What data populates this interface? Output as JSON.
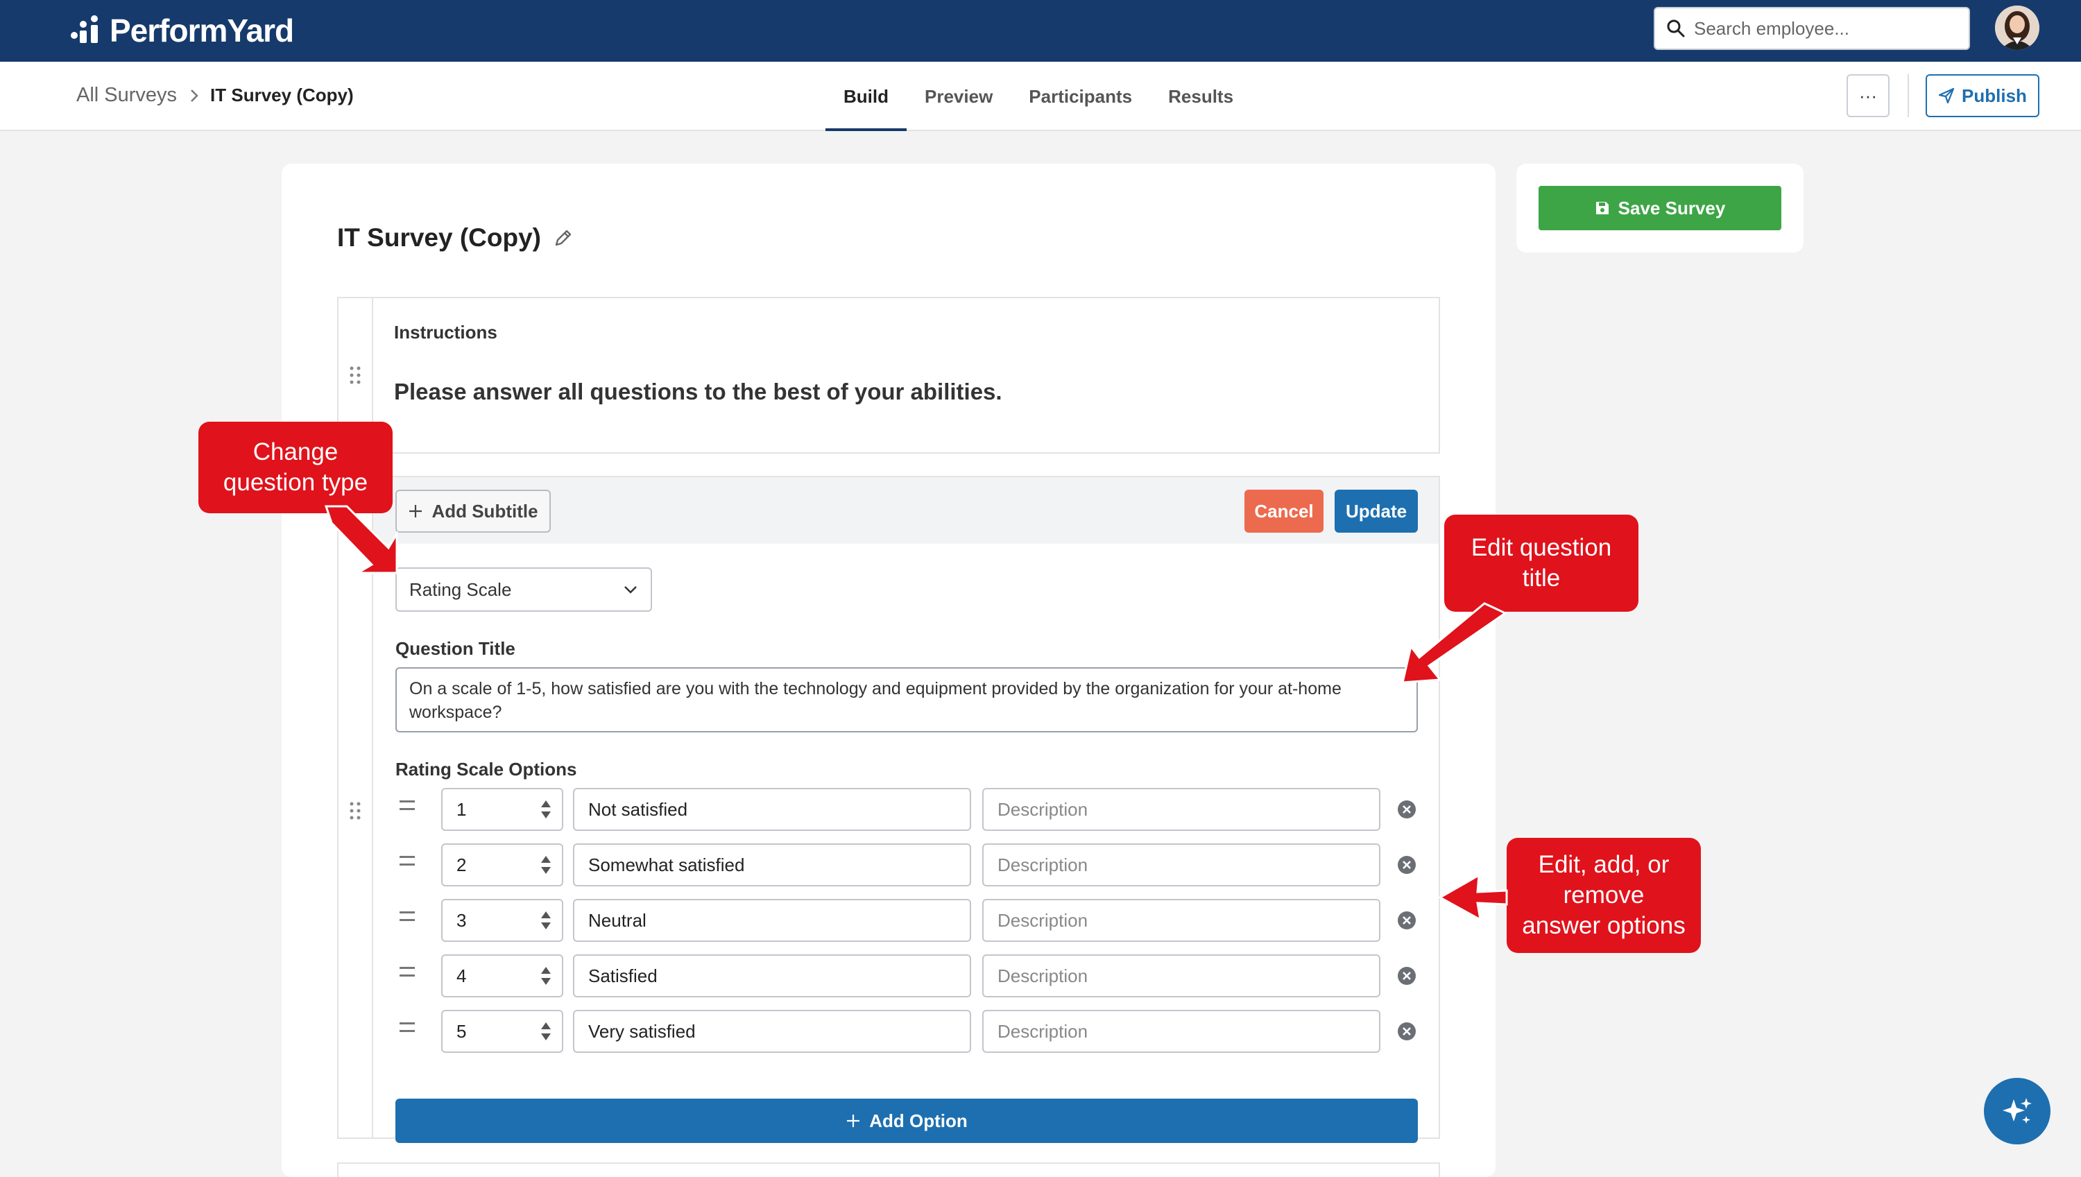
{
  "app": {
    "name": "PerformYard"
  },
  "search": {
    "placeholder": "Search employee..."
  },
  "breadcrumb": {
    "root": "All Surveys",
    "current": "IT Survey (Copy)"
  },
  "tabs": [
    {
      "label": "Build",
      "active": true
    },
    {
      "label": "Preview",
      "active": false
    },
    {
      "label": "Participants",
      "active": false
    },
    {
      "label": "Results",
      "active": false
    }
  ],
  "header_actions": {
    "more": "···",
    "publish": "Publish"
  },
  "survey": {
    "title": "IT Survey (Copy)"
  },
  "instructions": {
    "label": "Instructions",
    "text": "Please answer all questions to the best of your abilities."
  },
  "question": {
    "add_subtitle": "Add Subtitle",
    "cancel": "Cancel",
    "update": "Update",
    "type": "Rating Scale",
    "title_label": "Question Title",
    "title_value": "On a scale of 1-5, how satisfied are you with the technology and equipment provided by the organization for your at-home workspace?",
    "options_label": "Rating Scale Options",
    "description_placeholder": "Description",
    "options": [
      {
        "value": "1",
        "label": "Not satisfied"
      },
      {
        "value": "2",
        "label": "Somewhat satisfied"
      },
      {
        "value": "3",
        "label": "Neutral"
      },
      {
        "value": "4",
        "label": "Satisfied"
      },
      {
        "value": "5",
        "label": "Very satisfied"
      }
    ],
    "add_option": "Add Option"
  },
  "side": {
    "save": "Save Survey"
  },
  "callouts": {
    "type": {
      "line1": "Change",
      "line2": "question type"
    },
    "title": {
      "line1": "Edit question",
      "line2": "title"
    },
    "options": {
      "line1": "Edit, add, or",
      "line2": "remove",
      "line3": "answer options"
    }
  },
  "colors": {
    "navbar": "#163a6b",
    "primary": "#1d6fb0",
    "save": "#3ea546",
    "cancel": "#ec6a4d",
    "callout": "#e0121b"
  }
}
